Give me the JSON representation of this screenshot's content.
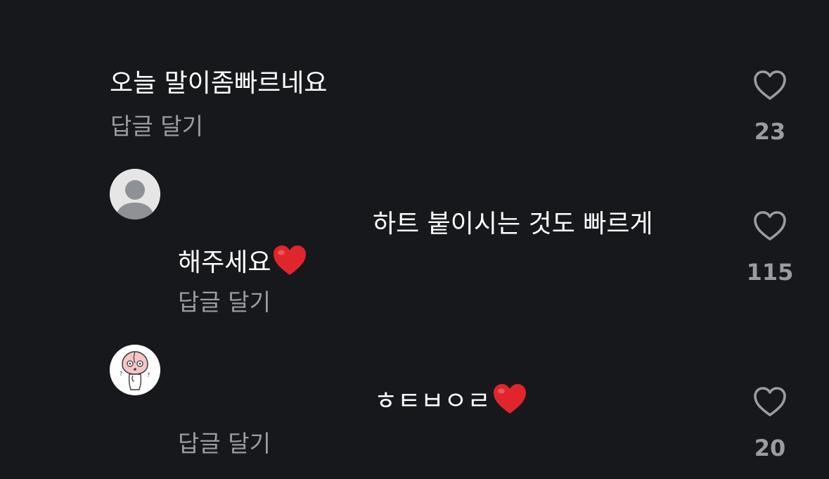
{
  "comments": [
    {
      "text": "오늘 말이좀빠르네요",
      "reply_label": "답글 달기",
      "likes": "23"
    },
    {
      "text_line1": "하트 붙이시는 것도 빠르게",
      "text_line2": "해주세요",
      "emoji": "red-heart-emoji",
      "reply_label": "답글 달기",
      "likes": "115",
      "avatar": "default-user-avatar"
    },
    {
      "text": "ㅎㅌㅂㅇㄹ",
      "emoji": "red-heart-emoji",
      "reply_label": "답글 달기",
      "likes": "20",
      "avatar": "peach-character-avatar"
    }
  ],
  "colors": {
    "background": "#17181c",
    "text_primary": "#ffffff",
    "text_secondary": "#9a9ca3",
    "heart_emoji": "#e0252c"
  },
  "icons": {
    "like": "heart-outline-icon"
  }
}
